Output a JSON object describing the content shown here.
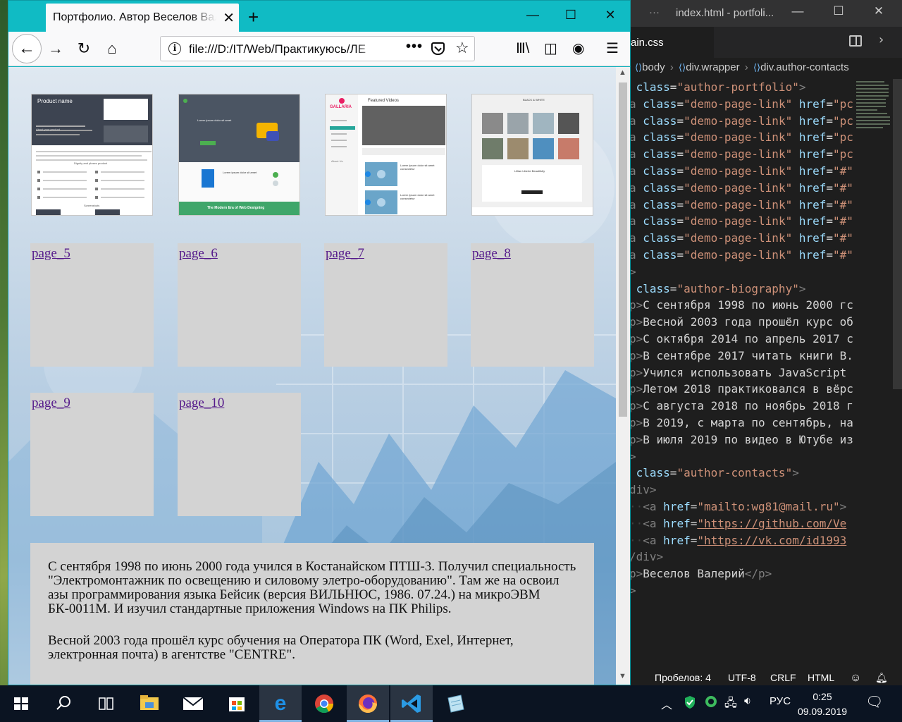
{
  "vscode": {
    "title": "index.html - portfoli...",
    "tab_label": "ain.css",
    "breadcrumbs": [
      "body",
      "div.wrapper",
      "div.author-contacts"
    ],
    "code_lines": [
      [
        {
          "c": "c-attr",
          "t": " class"
        },
        {
          "c": "c-txt",
          "t": "="
        },
        {
          "c": "c-str",
          "t": "\"author-portfolio\""
        },
        {
          "c": "c-tag",
          "t": ">"
        }
      ],
      [
        {
          "c": "c-tag",
          "t": "a "
        },
        {
          "c": "c-attr",
          "t": "class"
        },
        {
          "c": "c-txt",
          "t": "="
        },
        {
          "c": "c-str",
          "t": "\"demo-page-link\""
        },
        {
          "c": "c-txt",
          "t": " "
        },
        {
          "c": "c-attr",
          "t": "href"
        },
        {
          "c": "c-txt",
          "t": "="
        },
        {
          "c": "c-str",
          "t": "\"pc"
        }
      ],
      [
        {
          "c": "c-tag",
          "t": "a "
        },
        {
          "c": "c-attr",
          "t": "class"
        },
        {
          "c": "c-txt",
          "t": "="
        },
        {
          "c": "c-str",
          "t": "\"demo-page-link\""
        },
        {
          "c": "c-txt",
          "t": " "
        },
        {
          "c": "c-attr",
          "t": "href"
        },
        {
          "c": "c-txt",
          "t": "="
        },
        {
          "c": "c-str",
          "t": "\"pc"
        }
      ],
      [
        {
          "c": "c-tag",
          "t": "a "
        },
        {
          "c": "c-attr",
          "t": "class"
        },
        {
          "c": "c-txt",
          "t": "="
        },
        {
          "c": "c-str",
          "t": "\"demo-page-link\""
        },
        {
          "c": "c-txt",
          "t": " "
        },
        {
          "c": "c-attr",
          "t": "href"
        },
        {
          "c": "c-txt",
          "t": "="
        },
        {
          "c": "c-str",
          "t": "\"pc"
        }
      ],
      [
        {
          "c": "c-tag",
          "t": "a "
        },
        {
          "c": "c-attr",
          "t": "class"
        },
        {
          "c": "c-txt",
          "t": "="
        },
        {
          "c": "c-str",
          "t": "\"demo-page-link\""
        },
        {
          "c": "c-txt",
          "t": " "
        },
        {
          "c": "c-attr",
          "t": "href"
        },
        {
          "c": "c-txt",
          "t": "="
        },
        {
          "c": "c-str",
          "t": "\"pc"
        }
      ],
      [
        {
          "c": "c-tag",
          "t": "a "
        },
        {
          "c": "c-attr",
          "t": "class"
        },
        {
          "c": "c-txt",
          "t": "="
        },
        {
          "c": "c-str",
          "t": "\"demo-page-link\""
        },
        {
          "c": "c-txt",
          "t": " "
        },
        {
          "c": "c-attr",
          "t": "href"
        },
        {
          "c": "c-txt",
          "t": "="
        },
        {
          "c": "c-str",
          "t": "\"#\""
        }
      ],
      [
        {
          "c": "c-tag",
          "t": "a "
        },
        {
          "c": "c-attr",
          "t": "class"
        },
        {
          "c": "c-txt",
          "t": "="
        },
        {
          "c": "c-str",
          "t": "\"demo-page-link\""
        },
        {
          "c": "c-txt",
          "t": " "
        },
        {
          "c": "c-attr",
          "t": "href"
        },
        {
          "c": "c-txt",
          "t": "="
        },
        {
          "c": "c-str",
          "t": "\"#\""
        }
      ],
      [
        {
          "c": "c-tag",
          "t": "a "
        },
        {
          "c": "c-attr",
          "t": "class"
        },
        {
          "c": "c-txt",
          "t": "="
        },
        {
          "c": "c-str",
          "t": "\"demo-page-link\""
        },
        {
          "c": "c-txt",
          "t": " "
        },
        {
          "c": "c-attr",
          "t": "href"
        },
        {
          "c": "c-txt",
          "t": "="
        },
        {
          "c": "c-str",
          "t": "\"#\""
        }
      ],
      [
        {
          "c": "c-tag",
          "t": "a "
        },
        {
          "c": "c-attr",
          "t": "class"
        },
        {
          "c": "c-txt",
          "t": "="
        },
        {
          "c": "c-str",
          "t": "\"demo-page-link\""
        },
        {
          "c": "c-txt",
          "t": " "
        },
        {
          "c": "c-attr",
          "t": "href"
        },
        {
          "c": "c-txt",
          "t": "="
        },
        {
          "c": "c-str",
          "t": "\"#\""
        }
      ],
      [
        {
          "c": "c-tag",
          "t": "a "
        },
        {
          "c": "c-attr",
          "t": "class"
        },
        {
          "c": "c-txt",
          "t": "="
        },
        {
          "c": "c-str",
          "t": "\"demo-page-link\""
        },
        {
          "c": "c-txt",
          "t": " "
        },
        {
          "c": "c-attr",
          "t": "href"
        },
        {
          "c": "c-txt",
          "t": "="
        },
        {
          "c": "c-str",
          "t": "\"#\""
        }
      ],
      [
        {
          "c": "c-tag",
          "t": "a "
        },
        {
          "c": "c-attr",
          "t": "class"
        },
        {
          "c": "c-txt",
          "t": "="
        },
        {
          "c": "c-str",
          "t": "\"demo-page-link\""
        },
        {
          "c": "c-txt",
          "t": " "
        },
        {
          "c": "c-attr",
          "t": "href"
        },
        {
          "c": "c-txt",
          "t": "="
        },
        {
          "c": "c-str",
          "t": "\"#\""
        }
      ],
      [
        {
          "c": "c-tag",
          "t": ">"
        }
      ],
      [
        {
          "c": "c-attr",
          "t": " class"
        },
        {
          "c": "c-txt",
          "t": "="
        },
        {
          "c": "c-str",
          "t": "\"author-biography\""
        },
        {
          "c": "c-tag",
          "t": ">"
        }
      ],
      [
        {
          "c": "c-tag",
          "t": "p>"
        },
        {
          "c": "c-txt",
          "t": "С сентября 1998 по июнь 2000 гс"
        }
      ],
      [
        {
          "c": "c-tag",
          "t": "p>"
        },
        {
          "c": "c-txt",
          "t": "Весной 2003 года прошёл курс об"
        }
      ],
      [
        {
          "c": "c-tag",
          "t": "p>"
        },
        {
          "c": "c-txt",
          "t": "С октября 2014 по апрель 2017 с"
        }
      ],
      [
        {
          "c": "c-tag",
          "t": "p>"
        },
        {
          "c": "c-txt",
          "t": "В сентябре 2017 читать книги В."
        }
      ],
      [
        {
          "c": "c-tag",
          "t": "p>"
        },
        {
          "c": "c-txt",
          "t": "Учился использовать JavaScript "
        }
      ],
      [
        {
          "c": "c-tag",
          "t": "p>"
        },
        {
          "c": "c-txt",
          "t": "Летом 2018 практиковался в вёрс"
        }
      ],
      [
        {
          "c": "c-tag",
          "t": "p>"
        },
        {
          "c": "c-txt",
          "t": "С августа 2018 по ноябрь 2018 г"
        }
      ],
      [
        {
          "c": "c-tag",
          "t": "p>"
        },
        {
          "c": "c-txt",
          "t": "В 2019, с марта по сентябрь, на"
        }
      ],
      [
        {
          "c": "c-tag",
          "t": "p>"
        },
        {
          "c": "c-txt",
          "t": "В июля 2019 по видео в Ютубе из"
        }
      ],
      [
        {
          "c": "c-tag",
          "t": ">"
        }
      ],
      [
        {
          "c": "c-attr",
          "t": " class"
        },
        {
          "c": "c-txt",
          "t": "="
        },
        {
          "c": "c-str",
          "t": "\"author-contacts\""
        },
        {
          "c": "c-tag",
          "t": ">"
        }
      ],
      [
        {
          "c": "c-tag",
          "t": "div>"
        }
      ],
      [
        {
          "c": "c-dim",
          "t": "··"
        },
        {
          "c": "c-tag",
          "t": "<a "
        },
        {
          "c": "c-attr",
          "t": "href"
        },
        {
          "c": "c-txt",
          "t": "="
        },
        {
          "c": "c-str",
          "t": "\"mailto:wg81@mail.ru\""
        },
        {
          "c": "c-tag",
          "t": ">"
        }
      ],
      [
        {
          "c": "c-dim",
          "t": "··"
        },
        {
          "c": "c-tag",
          "t": "<a "
        },
        {
          "c": "c-attr",
          "t": "href"
        },
        {
          "c": "c-txt",
          "t": "="
        },
        {
          "c": "c-link",
          "t": "\"https://github.com/Ve"
        }
      ],
      [
        {
          "c": "c-dim",
          "t": "··"
        },
        {
          "c": "c-tag",
          "t": "<a "
        },
        {
          "c": "c-attr",
          "t": "href"
        },
        {
          "c": "c-txt",
          "t": "="
        },
        {
          "c": "c-link",
          "t": "\"https://vk.com/id1993"
        }
      ],
      [
        {
          "c": "c-tag",
          "t": "/div>"
        }
      ],
      [
        {
          "c": "c-tag",
          "t": "p>"
        },
        {
          "c": "c-txt",
          "t": "Веселов Валерий"
        },
        {
          "c": "c-tag",
          "t": "</p>"
        }
      ],
      [
        {
          "c": "c-tag",
          "t": ">"
        }
      ]
    ],
    "status": {
      "spaces": "Пробелов: 4",
      "encoding": "UTF-8",
      "eol": "CRLF",
      "language": "HTML"
    }
  },
  "browser": {
    "tab_title": "Портфолио. Автор Веселов Валерий",
    "url": "file:///D:/IT/Web/Практикуюсь/ЛЕ",
    "page_links": [
      "page_5",
      "page_6",
      "page_7",
      "page_8",
      "page_9",
      "page_10"
    ],
    "thumbnails": [
      {
        "heading": "Product name",
        "sub": "About your product",
        "section": "Dignity and pluses product",
        "footer": "Screenshots"
      },
      {
        "heading": "Lorem ipsum dolor sit amet",
        "mid": "Lorem ipsum dolor sit amet",
        "footer": "The Modern Era of Web Designing"
      },
      {
        "brand": "GALLARIA",
        "tab": "Featured Videos",
        "item1": "Lorem Ipsum dolor sit amet consectetur",
        "item2": "Lorem Ipsum dolor sit amet consectetur",
        "side": "About Us"
      },
      {
        "brand": "BLACK & WHITE",
        "caption": "Lillian Liberte Beautifully"
      }
    ],
    "biography": [
      "С сентября 1998 по июнь 2000 года учился в Костанайском ПТШ-3. Получил специальность \"Электромонтажник по освещению и силовому элетро-оборудованию\". Там же на освоил азы программирования языка Бейсик (версия ВИЛЬНЮС, 1986. 07.24.) на микроЭВМ БК-0011М. И изучил стандартные приложения Windows на ПК Philips.",
      "Весной 2003 года прошёл курс обучения на Оператора ПК (Word, Exel, Интернет, электронная почта) в агентстве \"CENTRE\"."
    ]
  },
  "taskbar": {
    "language": "РУС",
    "time": "0:25",
    "date": "09.09.2019",
    "apps": [
      "start-icon",
      "search-icon",
      "task-view-icon",
      "file-explorer-icon",
      "mail-icon",
      "store-icon",
      "edge-icon",
      "chrome-icon",
      "firefox-icon",
      "vscode-icon",
      "notepad-icon"
    ]
  }
}
